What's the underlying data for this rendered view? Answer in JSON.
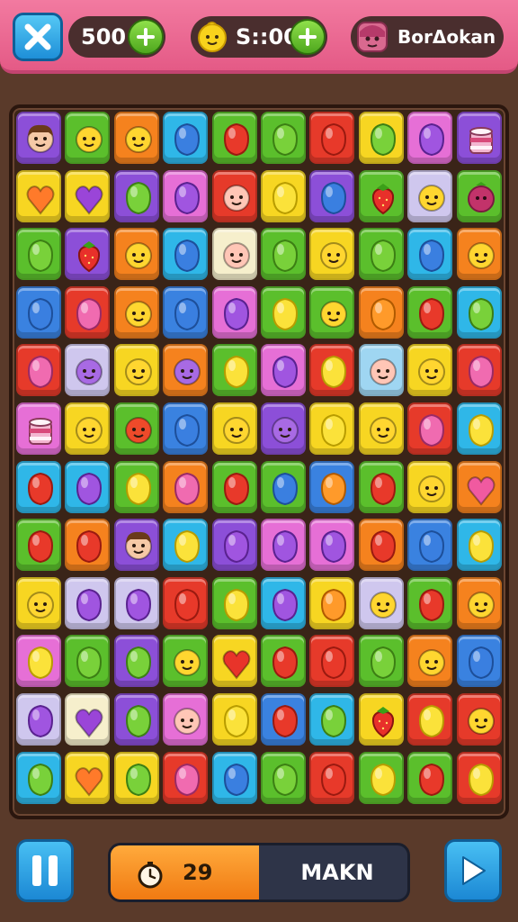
{
  "header": {
    "coins_value": "500",
    "timer_value": "S::00",
    "player_name": "BorΔokan"
  },
  "status": {
    "moves_value": "29",
    "label": "MAKN",
    "progress_fraction": 0.5
  },
  "colors": {
    "purple": "#8c4fd8",
    "green": "#5bbf2c",
    "orange": "#f5821e",
    "cyan": "#2fb7e8",
    "red": "#e63a2a",
    "yellow": "#f7d622",
    "pink": "#e66fd6",
    "blue": "#3a82e0",
    "lightblue": "#9fd6f2",
    "cream": "#f6efcc",
    "lavender": "#cfc7ee"
  },
  "board": {
    "rows": 12,
    "cols": 10,
    "tiles": [
      [
        {
          "c": "purple",
          "i": "face-boy"
        },
        {
          "c": "green",
          "i": "face-yellow"
        },
        {
          "c": "orange",
          "i": "face-yellow"
        },
        {
          "c": "cyan",
          "i": "gem-blue"
        },
        {
          "c": "green",
          "i": "gem-red"
        },
        {
          "c": "green",
          "i": "gem-green"
        },
        {
          "c": "red",
          "i": "gem-red"
        },
        {
          "c": "yellow",
          "i": "gem-green"
        },
        {
          "c": "pink",
          "i": "gem-purple"
        },
        {
          "c": "purple",
          "i": "cake"
        }
      ],
      [
        {
          "c": "yellow",
          "i": "heart-orange"
        },
        {
          "c": "yellow",
          "i": "heart-purple"
        },
        {
          "c": "purple",
          "i": "gem-green"
        },
        {
          "c": "pink",
          "i": "gem-purple"
        },
        {
          "c": "red",
          "i": "face-pink"
        },
        {
          "c": "yellow",
          "i": "gem-yellow"
        },
        {
          "c": "purple",
          "i": "gem-blue"
        },
        {
          "c": "green",
          "i": "strawberry"
        },
        {
          "c": "lavender",
          "i": "face-yellow"
        },
        {
          "c": "green",
          "i": "berry"
        }
      ],
      [
        {
          "c": "green",
          "i": "gem-green"
        },
        {
          "c": "purple",
          "i": "strawberry"
        },
        {
          "c": "orange",
          "i": "face-yellow"
        },
        {
          "c": "cyan",
          "i": "gem-blue"
        },
        {
          "c": "cream",
          "i": "face-pink"
        },
        {
          "c": "green",
          "i": "gem-green"
        },
        {
          "c": "yellow",
          "i": "face-yellow"
        },
        {
          "c": "green",
          "i": "gem-green"
        },
        {
          "c": "cyan",
          "i": "gem-blue"
        },
        {
          "c": "orange",
          "i": "face-yellow"
        }
      ],
      [
        {
          "c": "blue",
          "i": "gem-blue"
        },
        {
          "c": "red",
          "i": "gem-pink"
        },
        {
          "c": "orange",
          "i": "face-yellow"
        },
        {
          "c": "blue",
          "i": "gem-blue"
        },
        {
          "c": "pink",
          "i": "gem-purple"
        },
        {
          "c": "green",
          "i": "gem-yellow"
        },
        {
          "c": "green",
          "i": "face-yellow"
        },
        {
          "c": "orange",
          "i": "gem-orange"
        },
        {
          "c": "green",
          "i": "gem-red"
        },
        {
          "c": "cyan",
          "i": "gem-green"
        }
      ],
      [
        {
          "c": "red",
          "i": "gem-pink"
        },
        {
          "c": "lavender",
          "i": "face-purple"
        },
        {
          "c": "yellow",
          "i": "face-yellow"
        },
        {
          "c": "orange",
          "i": "face-purple"
        },
        {
          "c": "green",
          "i": "gem-yellow"
        },
        {
          "c": "pink",
          "i": "gem-purple"
        },
        {
          "c": "red",
          "i": "gem-yellow"
        },
        {
          "c": "lightblue",
          "i": "face-pink"
        },
        {
          "c": "yellow",
          "i": "face-yellow"
        },
        {
          "c": "red",
          "i": "gem-pink"
        }
      ],
      [
        {
          "c": "pink",
          "i": "cake"
        },
        {
          "c": "yellow",
          "i": "face-yellow"
        },
        {
          "c": "green",
          "i": "face-red"
        },
        {
          "c": "blue",
          "i": "gem-blue"
        },
        {
          "c": "yellow",
          "i": "face-yellow"
        },
        {
          "c": "purple",
          "i": "face-purple"
        },
        {
          "c": "yellow",
          "i": "gem-yellow"
        },
        {
          "c": "yellow",
          "i": "face-yellow"
        },
        {
          "c": "red",
          "i": "gem-pink"
        },
        {
          "c": "cyan",
          "i": "gem-yellow"
        }
      ],
      [
        {
          "c": "cyan",
          "i": "gem-red"
        },
        {
          "c": "cyan",
          "i": "gem-purple"
        },
        {
          "c": "green",
          "i": "gem-yellow"
        },
        {
          "c": "orange",
          "i": "gem-pink"
        },
        {
          "c": "green",
          "i": "gem-red"
        },
        {
          "c": "green",
          "i": "gem-blue"
        },
        {
          "c": "blue",
          "i": "gem-orange"
        },
        {
          "c": "green",
          "i": "gem-red"
        },
        {
          "c": "yellow",
          "i": "face-yellow"
        },
        {
          "c": "orange",
          "i": "heart-pink"
        }
      ],
      [
        {
          "c": "green",
          "i": "gem-red"
        },
        {
          "c": "orange",
          "i": "gem-red"
        },
        {
          "c": "purple",
          "i": "face-boy"
        },
        {
          "c": "cyan",
          "i": "gem-yellow"
        },
        {
          "c": "purple",
          "i": "gem-purple"
        },
        {
          "c": "pink",
          "i": "gem-purple"
        },
        {
          "c": "pink",
          "i": "gem-purple"
        },
        {
          "c": "orange",
          "i": "gem-red"
        },
        {
          "c": "blue",
          "i": "gem-blue"
        },
        {
          "c": "cyan",
          "i": "gem-yellow"
        }
      ],
      [
        {
          "c": "yellow",
          "i": "face-yellow"
        },
        {
          "c": "lavender",
          "i": "gem-purple"
        },
        {
          "c": "lavender",
          "i": "gem-purple"
        },
        {
          "c": "red",
          "i": "gem-red"
        },
        {
          "c": "green",
          "i": "gem-yellow"
        },
        {
          "c": "cyan",
          "i": "gem-purple"
        },
        {
          "c": "yellow",
          "i": "gem-orange"
        },
        {
          "c": "lavender",
          "i": "face-yellow"
        },
        {
          "c": "green",
          "i": "gem-red"
        },
        {
          "c": "orange",
          "i": "face-yellow"
        }
      ],
      [
        {
          "c": "pink",
          "i": "gem-yellow"
        },
        {
          "c": "green",
          "i": "gem-green"
        },
        {
          "c": "purple",
          "i": "gem-green"
        },
        {
          "c": "green",
          "i": "face-yellow"
        },
        {
          "c": "yellow",
          "i": "heart-red"
        },
        {
          "c": "green",
          "i": "gem-red"
        },
        {
          "c": "red",
          "i": "gem-red"
        },
        {
          "c": "green",
          "i": "gem-green"
        },
        {
          "c": "orange",
          "i": "face-yellow"
        },
        {
          "c": "blue",
          "i": "gem-blue"
        }
      ],
      [
        {
          "c": "lavender",
          "i": "gem-purple"
        },
        {
          "c": "cream",
          "i": "heart-purple"
        },
        {
          "c": "purple",
          "i": "gem-green"
        },
        {
          "c": "pink",
          "i": "face-pink"
        },
        {
          "c": "yellow",
          "i": "gem-yellow"
        },
        {
          "c": "blue",
          "i": "gem-red"
        },
        {
          "c": "cyan",
          "i": "gem-green"
        },
        {
          "c": "yellow",
          "i": "strawberry"
        },
        {
          "c": "red",
          "i": "gem-yellow"
        },
        {
          "c": "red",
          "i": "face-yellow"
        }
      ],
      [
        {
          "c": "cyan",
          "i": "gem-green"
        },
        {
          "c": "yellow",
          "i": "heart-orange"
        },
        {
          "c": "yellow",
          "i": "gem-green"
        },
        {
          "c": "red",
          "i": "gem-pink"
        },
        {
          "c": "cyan",
          "i": "gem-blue"
        },
        {
          "c": "green",
          "i": "gem-green"
        },
        {
          "c": "red",
          "i": "gem-red"
        },
        {
          "c": "green",
          "i": "gem-yellow"
        },
        {
          "c": "green",
          "i": "gem-red"
        },
        {
          "c": "red",
          "i": "gem-yellow"
        }
      ]
    ]
  }
}
